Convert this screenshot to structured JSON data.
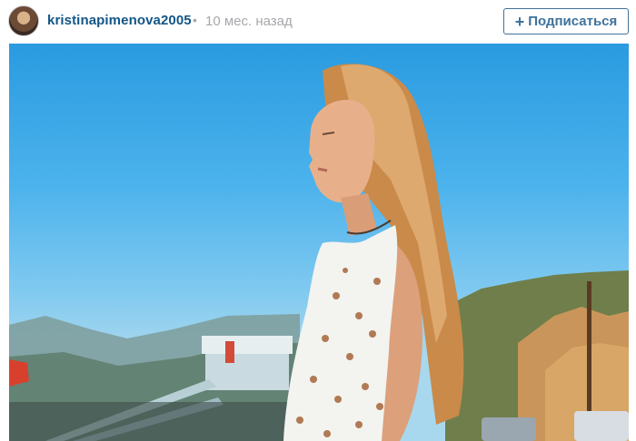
{
  "post": {
    "username": "kristinapimenova2005",
    "separator": "•",
    "time_ago": "10 мес. назад",
    "follow_label": "Подписаться",
    "follow_icon": "plus-icon"
  },
  "photo": {
    "icon": "photo-image"
  },
  "colors": {
    "username": "#125688",
    "muted": "#a5a7aa",
    "button": "#3f729b"
  }
}
